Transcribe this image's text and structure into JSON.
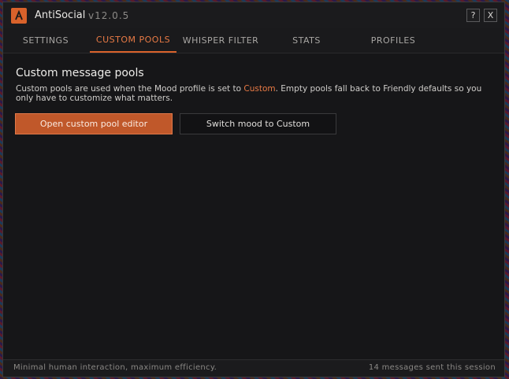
{
  "app": {
    "name": "AntiSocial",
    "version": "v12.0.5",
    "logo_icon": "antisocial-logo-icon",
    "accent_color": "#d9622b"
  },
  "window_controls": {
    "help_label": "?",
    "close_label": "X"
  },
  "tabs": [
    {
      "label": "SETTINGS",
      "active": false
    },
    {
      "label": "CUSTOM POOLS",
      "active": true
    },
    {
      "label": "WHISPER FILTER",
      "active": false
    },
    {
      "label": "STATS",
      "active": false
    },
    {
      "label": "PROFILES",
      "active": false
    }
  ],
  "main": {
    "title": "Custom message pools",
    "description_before": "Custom pools are used when the Mood profile is set to ",
    "description_highlight": "Custom",
    "description_after": ". Empty pools fall back to Friendly defaults so you only have to customize what matters.",
    "primary_button": "Open custom pool editor",
    "secondary_button": "Switch mood to Custom"
  },
  "status": {
    "left": "Minimal human interaction, maximum efficiency.",
    "right": "14 messages sent this session"
  }
}
